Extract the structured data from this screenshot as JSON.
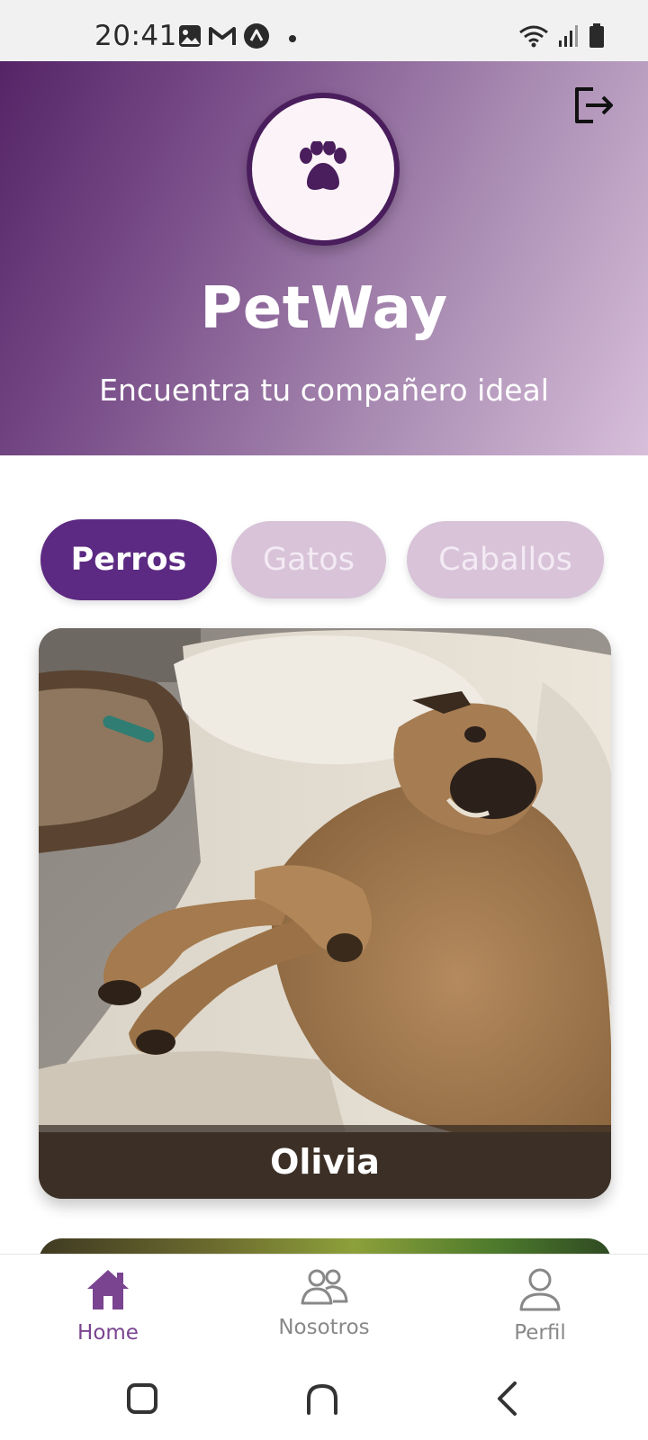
{
  "status_bar": {
    "time": "20:41",
    "left_icons": [
      "gallery-icon",
      "gmail-icon",
      "app-icon",
      "dot-icon"
    ],
    "right_icons": [
      "wifi-icon",
      "signal-icon",
      "battery-icon"
    ]
  },
  "header": {
    "title": "PetWay",
    "subtitle": "Encuentra tu compañero ideal",
    "logo_icon": "paw-icon",
    "logout_icon": "logout-icon",
    "colors": {
      "gradient_start": "#552466",
      "gradient_end": "#d7bfda",
      "logo_ring": "#4a1d5c"
    }
  },
  "tabs": [
    {
      "label": "Perros",
      "selected": true
    },
    {
      "label": "Gatos",
      "selected": false
    },
    {
      "label": "Caballos",
      "selected": false
    }
  ],
  "pets": [
    {
      "name": "Olivia",
      "species": "Perros"
    }
  ],
  "bottom_nav": {
    "items": [
      {
        "label": "Home",
        "icon": "home-icon",
        "active": true
      },
      {
        "label": "Nosotros",
        "icon": "people-icon",
        "active": false
      },
      {
        "label": "Perfil",
        "icon": "user-icon",
        "active": false
      }
    ]
  },
  "system_nav": [
    "recent-apps-icon",
    "home-icon",
    "back-icon"
  ],
  "colors": {
    "accent": "#5c2a82",
    "tab_inactive": "#d8c3d9",
    "nav_active": "#7a4490",
    "nav_inactive": "#888888"
  }
}
